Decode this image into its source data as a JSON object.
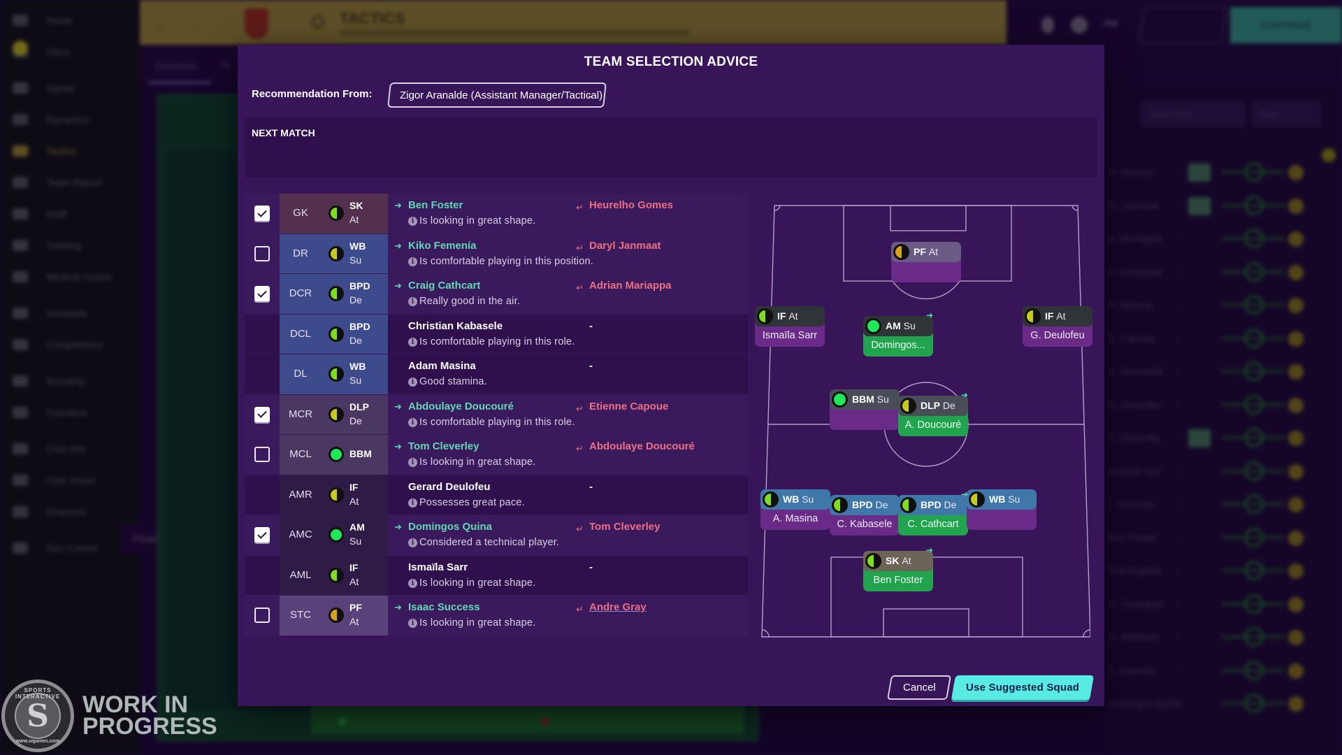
{
  "background": {
    "sidebar": {
      "items": [
        {
          "label": "Home",
          "icon": "home-icon"
        },
        {
          "label": "Inbox",
          "icon": "inbox-icon"
        },
        {
          "label": "Squad",
          "icon": "squad-icon"
        },
        {
          "label": "Dynamics",
          "icon": "dynamics-icon"
        },
        {
          "label": "Tactics",
          "icon": "tactics-icon",
          "active": true
        },
        {
          "label": "Team Report",
          "icon": "report-icon"
        },
        {
          "label": "Staff",
          "icon": "staff-icon"
        },
        {
          "label": "Training",
          "icon": "training-icon"
        },
        {
          "label": "Medical Centre",
          "icon": "medical-icon"
        },
        {
          "label": "Schedule",
          "icon": "schedule-icon"
        },
        {
          "label": "Competitions",
          "icon": "trophy-icon"
        },
        {
          "label": "Scouting",
          "icon": "search-icon"
        },
        {
          "label": "Transfers",
          "icon": "transfer-icon"
        },
        {
          "label": "Club Info",
          "icon": "shield-icon"
        },
        {
          "label": "Club Vision",
          "icon": "vision-icon"
        },
        {
          "label": "Finances",
          "icon": "money-icon"
        },
        {
          "label": "Dev. Centre",
          "icon": "dev-icon"
        }
      ],
      "tooltip": "Finances"
    },
    "topbar": {
      "title": "TACTICS",
      "continue_label": "CONTINUE",
      "fm_label": "FM"
    },
    "subnav": {
      "tabs": [
        "Overview",
        "Te"
      ]
    },
    "right_panel": {
      "quick_pick": "Quick Pick",
      "filter": "Filter",
      "rows": [
        "H. Gomes",
        "D. Janmaat",
        "A. Mariappa",
        "C. Kabasele",
        "A. Masina",
        "E. Capoue",
        "A. Doucouré",
        "G. Deulofeu",
        "T. Cleverley",
        "Ismaïla Sarr",
        "I. Success",
        "Ben Foster",
        "Will Hughes",
        "N. Chalobah",
        "D. Welbeck",
        "T. Dawson",
        "Domingos Quina"
      ]
    },
    "watermark": {
      "line1": "WORK IN",
      "line2": "PROGRESS",
      "logo_top": "SPORTS INTERACTIVE",
      "logo_bottom": "www.sigames.com"
    }
  },
  "modal": {
    "title": "TEAM SELECTION ADVICE",
    "recommendation_label": "Recommendation From:",
    "recommendation_value": "Zigor Aranalde (Assistant Manager/Tactical)",
    "next_match_label": "NEXT MATCH",
    "rows": [
      {
        "checkbox": "checked",
        "position": "GK",
        "role": "SK",
        "duty": "At",
        "suit": "high",
        "suggested": "Ben Foster",
        "current": "Heurelho Gomes",
        "reason": "Is looking in great shape.",
        "change": true
      },
      {
        "checkbox": "unchecked",
        "position": "DR",
        "role": "WB",
        "duty": "Su",
        "suit": "medium",
        "suggested": "Kiko Femenía",
        "current": "Daryl Janmaat",
        "reason": "Is comfortable playing in this position.",
        "change": true
      },
      {
        "checkbox": "checked",
        "position": "DCR",
        "role": "BPD",
        "duty": "De",
        "suit": "high",
        "suggested": "Craig Cathcart",
        "current": "Adrian Mariappa",
        "reason": "Really good in the air.",
        "change": true
      },
      {
        "checkbox": "none",
        "position": "DCL",
        "role": "BPD",
        "duty": "De",
        "suit": "high",
        "suggested": "Christian Kabasele",
        "current": "-",
        "reason": "Is comfortable playing in this role.",
        "change": false
      },
      {
        "checkbox": "none",
        "position": "DL",
        "role": "WB",
        "duty": "Su",
        "suit": "high",
        "suggested": "Adam Masina",
        "current": "-",
        "reason": "Good stamina.",
        "change": false
      },
      {
        "checkbox": "checked",
        "position": "MCR",
        "role": "DLP",
        "duty": "De",
        "suit": "medium",
        "suggested": "Abdoulaye Doucouré",
        "current": "Etienne Capoue",
        "reason": "Is comfortable playing in this role.",
        "change": true
      },
      {
        "checkbox": "unchecked",
        "position": "MCL",
        "role": "BBM",
        "duty": "",
        "suit": "full",
        "suggested": "Tom Cleverley",
        "current": "Abdoulaye Doucouré",
        "reason": "Is looking in great shape.",
        "change": true
      },
      {
        "checkbox": "none",
        "position": "AMR",
        "role": "IF",
        "duty": "At",
        "suit": "medium",
        "suggested": "Gerard Deulofeu",
        "current": "-",
        "reason": "Possesses great pace.",
        "change": false
      },
      {
        "checkbox": "checked",
        "position": "AMC",
        "role": "AM",
        "duty": "Su",
        "suit": "full",
        "suggested": "Domingos Quina",
        "current": "Tom Cleverley",
        "reason": "Considered a technical player.",
        "change": true
      },
      {
        "checkbox": "none",
        "position": "AML",
        "role": "IF",
        "duty": "At",
        "suit": "high",
        "suggested": "Ismaïla Sarr",
        "current": "-",
        "reason": "Is looking in great shape.",
        "change": false
      },
      {
        "checkbox": "unchecked",
        "position": "STC",
        "role": "PF",
        "duty": "At",
        "suit": "low",
        "suggested": "Isaac Success",
        "current": "Andre Gray",
        "reason": "Is looking in great shape.",
        "change": true,
        "current_link": true
      }
    ],
    "pitch": [
      {
        "id": "stc",
        "role": "PF",
        "duty": "At",
        "name": "",
        "suit": "low",
        "line": "st",
        "selected": false,
        "swap": false
      },
      {
        "id": "aml",
        "role": "IF",
        "duty": "At",
        "name": "Ismaïla Sarr",
        "suit": "high",
        "line": "att",
        "selected": false,
        "swap": false
      },
      {
        "id": "amc",
        "role": "AM",
        "duty": "Su",
        "name": "Domingos...",
        "suit": "full",
        "line": "att",
        "selected": true,
        "swap": true
      },
      {
        "id": "amr",
        "role": "IF",
        "duty": "At",
        "name": "G. Deulofeu",
        "suit": "medium",
        "line": "att",
        "selected": false,
        "swap": false
      },
      {
        "id": "mcl",
        "role": "BBM",
        "duty": "Su",
        "name": "",
        "suit": "full",
        "line": "mid",
        "selected": false,
        "swap": false
      },
      {
        "id": "mcr",
        "role": "DLP",
        "duty": "De",
        "name": "A. Doucouré",
        "suit": "medium",
        "line": "mid",
        "selected": true,
        "swap": true
      },
      {
        "id": "dl",
        "role": "WB",
        "duty": "Su",
        "name": "A. Masina",
        "suit": "high",
        "line": "def",
        "selected": false,
        "swap": false
      },
      {
        "id": "dcl",
        "role": "BPD",
        "duty": "De",
        "name": "C. Kabasele",
        "suit": "high",
        "line": "def",
        "selected": false,
        "swap": false
      },
      {
        "id": "dcr",
        "role": "BPD",
        "duty": "De",
        "name": "C. Cathcart",
        "suit": "high",
        "line": "def",
        "selected": true,
        "swap": true
      },
      {
        "id": "dr",
        "role": "WB",
        "duty": "Su",
        "name": "",
        "suit": "medium",
        "line": "def",
        "selected": false,
        "swap": false
      },
      {
        "id": "gk",
        "role": "SK",
        "duty": "At",
        "name": "Ben Foster",
        "suit": "high",
        "line": "gk",
        "selected": true,
        "swap": true
      }
    ],
    "cancel_label": "Cancel",
    "confirm_label": "Use Suggested Squad"
  },
  "colors": {
    "suit_high": "#7fdc1f",
    "suit_medium": "#c5cc1e",
    "suit_low": "#d6a21e",
    "suit_full": "#1fe85a",
    "suggested_name": "#63d6b4",
    "current_name": "#ec6f84",
    "modal_bg": "#381458",
    "accent_button": "#58ebe3",
    "pos_gk": "#54304f",
    "pos_def": "#3d4a8c",
    "pos_mid": "#4a3862",
    "pos_att": "#2e1b46",
    "pos_st": "#59427a"
  }
}
